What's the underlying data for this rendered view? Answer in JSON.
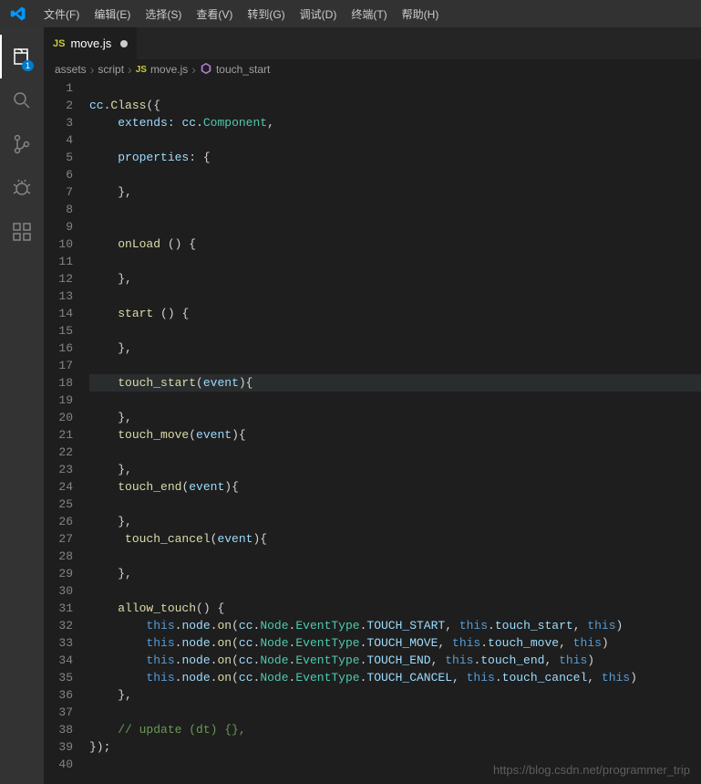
{
  "menubar": {
    "items": [
      "文件(F)",
      "编辑(E)",
      "选择(S)",
      "查看(V)",
      "转到(G)",
      "调试(D)",
      "终端(T)",
      "帮助(H)"
    ]
  },
  "activitybar": {
    "explorer_badge": "1"
  },
  "tab": {
    "icon_label": "JS",
    "filename": "move.js"
  },
  "breadcrumbs": {
    "seg0": "assets",
    "seg1": "script",
    "seg2_icon": "JS",
    "seg2": "move.js",
    "seg3": "touch_start"
  },
  "code": {
    "lines": [
      {
        "n": 1,
        "html": ""
      },
      {
        "n": 2,
        "html": "<span class='tok-prop'>cc</span><span class='tok-punc'>.</span><span class='tok-fn'>Class</span><span class='tok-punc'>({</span>"
      },
      {
        "n": 3,
        "html": "    <span class='tok-prop'>extends:</span> <span class='tok-prop'>cc</span><span class='tok-punc'>.</span><span class='tok-type'>Component</span><span class='tok-punc'>,</span>"
      },
      {
        "n": 4,
        "html": ""
      },
      {
        "n": 5,
        "html": "    <span class='tok-prop'>properties:</span> <span class='tok-punc'>{</span>"
      },
      {
        "n": 6,
        "html": ""
      },
      {
        "n": 7,
        "html": "    <span class='tok-punc'>},</span>"
      },
      {
        "n": 8,
        "html": ""
      },
      {
        "n": 9,
        "html": ""
      },
      {
        "n": 10,
        "html": "    <span class='tok-fn'>onLoad</span> <span class='tok-punc'>() {</span>"
      },
      {
        "n": 11,
        "html": ""
      },
      {
        "n": 12,
        "html": "    <span class='tok-punc'>},</span>"
      },
      {
        "n": 13,
        "html": ""
      },
      {
        "n": 14,
        "html": "    <span class='tok-fn'>start</span> <span class='tok-punc'>() {</span>"
      },
      {
        "n": 15,
        "html": ""
      },
      {
        "n": 16,
        "html": "    <span class='tok-punc'>},</span>"
      },
      {
        "n": 17,
        "html": ""
      },
      {
        "n": 18,
        "html": "    <span class='tok-fn'>touch_start</span><span class='tok-punc'>(</span><span class='tok-param'>event</span><span class='tok-punc'>){</span>",
        "hl": true
      },
      {
        "n": 19,
        "html": ""
      },
      {
        "n": 20,
        "html": "    <span class='tok-punc'>},</span>"
      },
      {
        "n": 21,
        "html": "    <span class='tok-fn'>touch_move</span><span class='tok-punc'>(</span><span class='tok-param'>event</span><span class='tok-punc'>){</span>"
      },
      {
        "n": 22,
        "html": ""
      },
      {
        "n": 23,
        "html": "    <span class='tok-punc'>},</span>"
      },
      {
        "n": 24,
        "html": "    <span class='tok-fn'>touch_end</span><span class='tok-punc'>(</span><span class='tok-param'>event</span><span class='tok-punc'>){</span>"
      },
      {
        "n": 25,
        "html": ""
      },
      {
        "n": 26,
        "html": "    <span class='tok-punc'>},</span>"
      },
      {
        "n": 27,
        "html": "     <span class='tok-fn'>touch_cancel</span><span class='tok-punc'>(</span><span class='tok-param'>event</span><span class='tok-punc'>){</span>"
      },
      {
        "n": 28,
        "html": ""
      },
      {
        "n": 29,
        "html": "    <span class='tok-punc'>},</span>"
      },
      {
        "n": 30,
        "html": ""
      },
      {
        "n": 31,
        "html": "    <span class='tok-fn'>allow_touch</span><span class='tok-punc'>() {</span>"
      },
      {
        "n": 32,
        "html": "        <span class='tok-kw'>this</span><span class='tok-punc'>.</span><span class='tok-prop'>node</span><span class='tok-punc'>.</span><span class='tok-fn'>on</span><span class='tok-punc'>(</span><span class='tok-prop'>cc</span><span class='tok-punc'>.</span><span class='tok-type'>Node</span><span class='tok-punc'>.</span><span class='tok-type'>EventType</span><span class='tok-punc'>.</span><span class='tok-prop'>TOUCH_START</span><span class='tok-punc'>, </span><span class='tok-kw'>this</span><span class='tok-punc'>.</span><span class='tok-prop'>touch_start</span><span class='tok-punc'>, </span><span class='tok-kw'>this</span><span class='tok-punc'>)</span>"
      },
      {
        "n": 33,
        "html": "        <span class='tok-kw'>this</span><span class='tok-punc'>.</span><span class='tok-prop'>node</span><span class='tok-punc'>.</span><span class='tok-fn'>on</span><span class='tok-punc'>(</span><span class='tok-prop'>cc</span><span class='tok-punc'>.</span><span class='tok-type'>Node</span><span class='tok-punc'>.</span><span class='tok-type'>EventType</span><span class='tok-punc'>.</span><span class='tok-prop'>TOUCH_MOVE</span><span class='tok-punc'>, </span><span class='tok-kw'>this</span><span class='tok-punc'>.</span><span class='tok-prop'>touch_move</span><span class='tok-punc'>, </span><span class='tok-kw'>this</span><span class='tok-punc'>)</span>"
      },
      {
        "n": 34,
        "html": "        <span class='tok-kw'>this</span><span class='tok-punc'>.</span><span class='tok-prop'>node</span><span class='tok-punc'>.</span><span class='tok-fn'>on</span><span class='tok-punc'>(</span><span class='tok-prop'>cc</span><span class='tok-punc'>.</span><span class='tok-type'>Node</span><span class='tok-punc'>.</span><span class='tok-type'>EventType</span><span class='tok-punc'>.</span><span class='tok-prop'>TOUCH_END</span><span class='tok-punc'>, </span><span class='tok-kw'>this</span><span class='tok-punc'>.</span><span class='tok-prop'>touch_end</span><span class='tok-punc'>, </span><span class='tok-kw'>this</span><span class='tok-punc'>)</span>"
      },
      {
        "n": 35,
        "html": "        <span class='tok-kw'>this</span><span class='tok-punc'>.</span><span class='tok-prop'>node</span><span class='tok-punc'>.</span><span class='tok-fn'>on</span><span class='tok-punc'>(</span><span class='tok-prop'>cc</span><span class='tok-punc'>.</span><span class='tok-type'>Node</span><span class='tok-punc'>.</span><span class='tok-type'>EventType</span><span class='tok-punc'>.</span><span class='tok-prop'>TOUCH_CANCEL</span><span class='tok-punc'>, </span><span class='tok-kw'>this</span><span class='tok-punc'>.</span><span class='tok-prop'>touch_cancel</span><span class='tok-punc'>, </span><span class='tok-kw'>this</span><span class='tok-punc'>)</span>"
      },
      {
        "n": 36,
        "html": "    <span class='tok-punc'>},</span>"
      },
      {
        "n": 37,
        "html": ""
      },
      {
        "n": 38,
        "html": "    <span class='tok-comment'>// update (dt) {},</span>"
      },
      {
        "n": 39,
        "html": "<span class='tok-punc'>});</span>"
      },
      {
        "n": 40,
        "html": ""
      }
    ]
  },
  "watermark": "https://blog.csdn.net/programmer_trip"
}
